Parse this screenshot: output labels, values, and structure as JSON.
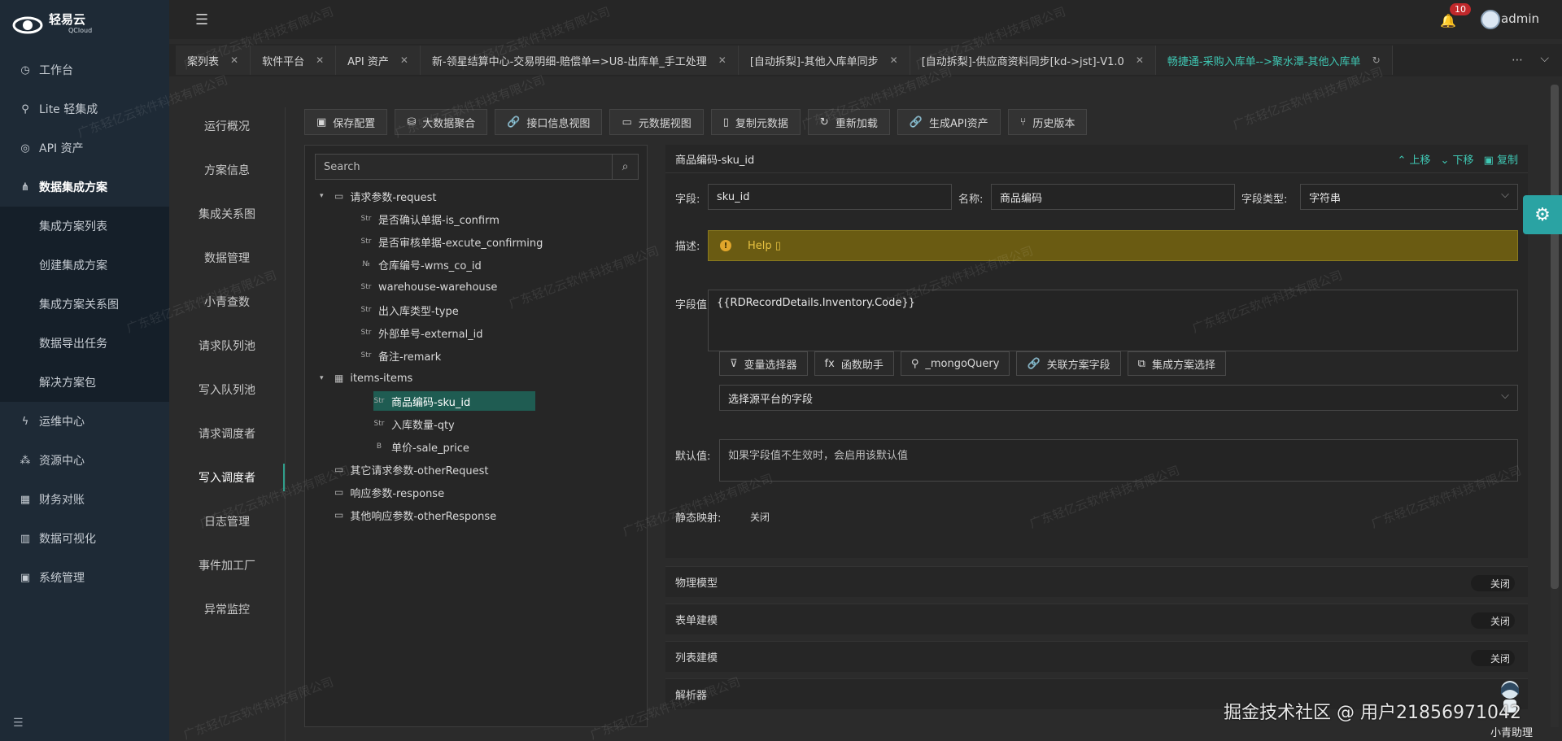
{
  "brand": {
    "name": "轻易云",
    "sub": "QCloud"
  },
  "nav": {
    "items": [
      {
        "label": "工作台",
        "icon": "clock-icon"
      },
      {
        "label": "Lite 轻集成",
        "icon": "bulb-icon"
      },
      {
        "label": "API 资产",
        "icon": "compass-icon"
      },
      {
        "label": "数据集成方案",
        "icon": "network-icon"
      }
    ],
    "subitems": [
      "集成方案列表",
      "创建集成方案",
      "集成方案关系图",
      "数据导出任务",
      "解决方案包"
    ],
    "items2": [
      {
        "label": "运维中心",
        "icon": "bolt-icon"
      },
      {
        "label": "资源中心",
        "icon": "resource-icon"
      },
      {
        "label": "财务对账",
        "icon": "calculator-icon"
      },
      {
        "label": "数据可视化",
        "icon": "bar-chart-icon"
      },
      {
        "label": "系统管理",
        "icon": "settings-grid-icon"
      }
    ]
  },
  "topbar": {
    "notification_count": "10",
    "username": "admin"
  },
  "tabs": [
    {
      "label": "案列表"
    },
    {
      "label": "软件平台"
    },
    {
      "label": "API 资产"
    },
    {
      "label": "新-领星结算中心-交易明细-赔偿单=>U8-出库单_手工处理"
    },
    {
      "label": "[自动拆梨]-其他入库单同步"
    },
    {
      "label": "[自动拆梨]-供应商资料同步[kd->jst]-V1.0"
    },
    {
      "label": "畅捷通-采购入库单-->聚水潭-其他入库单"
    }
  ],
  "submenu": [
    "运行概况",
    "方案信息",
    "集成关系图",
    "数据管理",
    "小青查数",
    "请求队列池",
    "写入队列池",
    "请求调度者",
    "写入调度者",
    "日志管理",
    "事件加工厂",
    "异常监控"
  ],
  "toolbar": [
    "保存配置",
    "大数据聚合",
    "接口信息视图",
    "元数据视图",
    "复制元数据",
    "重新加载",
    "生成API资产",
    "历史版本"
  ],
  "tree": {
    "search_placeholder": "Search",
    "nodes": [
      {
        "label": "请求参数-request",
        "type": "folder"
      },
      {
        "label": "是否确认单据-is_confirm",
        "type": "Str"
      },
      {
        "label": "是否审核单据-excute_confirming",
        "type": "Str"
      },
      {
        "label": "仓库编号-wms_co_id",
        "type": "No"
      },
      {
        "label": "warehouse-warehouse",
        "type": "Str"
      },
      {
        "label": "出入库类型-type",
        "type": "Str"
      },
      {
        "label": "外部单号-external_id",
        "type": "Str"
      },
      {
        "label": "备注-remark",
        "type": "Str"
      },
      {
        "label": "items-items",
        "type": "table"
      },
      {
        "label": "商品编码-sku_id",
        "type": "Str"
      },
      {
        "label": "入库数量-qty",
        "type": "Str"
      },
      {
        "label": "单价-sale_price",
        "type": "B"
      },
      {
        "label": "其它请求参数-otherRequest",
        "type": "folder"
      },
      {
        "label": "响应参数-response",
        "type": "folder"
      },
      {
        "label": "其他响应参数-otherResponse",
        "type": "folder"
      }
    ]
  },
  "panel": {
    "title": "商品编码-sku_id",
    "actions": {
      "up": "上移",
      "down": "下移",
      "copy": "复制"
    },
    "field_label": "字段:",
    "field_value": "sku_id",
    "name_label": "名称:",
    "name_value": "商品编码",
    "type_label": "字段类型:",
    "type_value": "字符串",
    "desc_label": "描述:",
    "help_text": "Help",
    "value_label": "字段值:",
    "value_text": "{{RDRecordDetails.Inventory.Code}}",
    "helpers": [
      "变量选择器",
      "函数助手",
      "_mongoQuery",
      "关联方案字段",
      "集成方案选择"
    ],
    "source_placeholder": "选择源平台的字段",
    "default_label": "默认值:",
    "default_placeholder": "如果字段值不生效时，会启用该默认值",
    "static_label": "静态映射:",
    "static_toggle": "关闭"
  },
  "sections": [
    {
      "label": "物理模型",
      "toggle": "关闭"
    },
    {
      "label": "表单建模",
      "toggle": "关闭"
    },
    {
      "label": "列表建模",
      "toggle": "关闭"
    },
    {
      "label": "解析器",
      "toggle": ""
    }
  ],
  "helper_label": "小青助理",
  "footer_mark": "掘金技术社区 @ 用户2185697​1042",
  "watermark": "广东轻亿云软件科技有限公司"
}
